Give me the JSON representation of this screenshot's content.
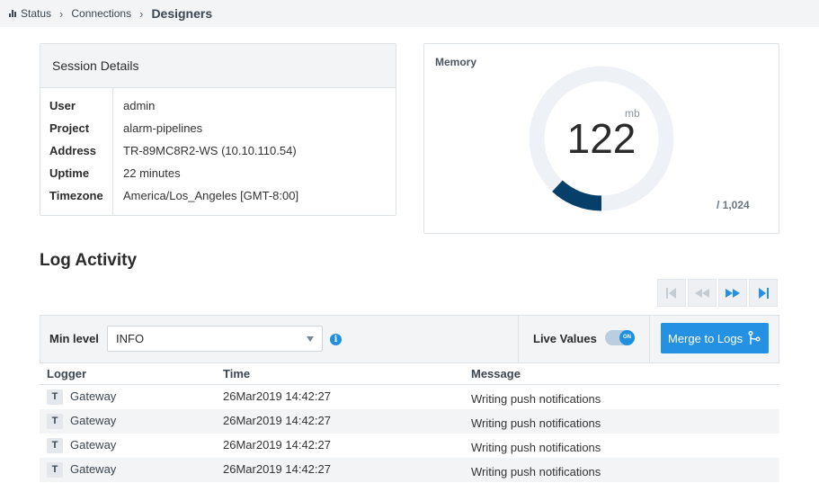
{
  "breadcrumb": {
    "items": [
      "Status",
      "Connections"
    ],
    "current": "Designers"
  },
  "session": {
    "title": "Session Details",
    "rows": [
      {
        "key": "User",
        "value": "admin"
      },
      {
        "key": "Project",
        "value": "alarm-pipelines"
      },
      {
        "key": "Address",
        "value": "TR-89MC8R2-WS (10.10.110.54)"
      },
      {
        "key": "Uptime",
        "value": "22 minutes"
      },
      {
        "key": "Timezone",
        "value": "America/Los_Angeles [GMT-8:00]"
      }
    ]
  },
  "memory": {
    "title": "Memory",
    "value": "122",
    "unit": "mb",
    "max_label": "/ 1,024",
    "used": 122,
    "total": 1024,
    "colors": {
      "track": "#eef2f6",
      "fill": "#053f6a"
    }
  },
  "log": {
    "title": "Log Activity",
    "pager_icons": [
      "first-page-icon",
      "previous-page-icon",
      "next-page-icon",
      "last-page-icon"
    ],
    "min_level_label": "Min level",
    "min_level_value": "INFO",
    "live_values_label": "Live Values",
    "toggle_text": "ON",
    "merge_button_label": "Merge to Logs",
    "columns": [
      "Logger",
      "Time",
      "Message"
    ],
    "rows": [
      {
        "badge": "T",
        "logger": "Gateway",
        "time": "26Mar2019 14:42:27",
        "message": "Writing push notifications"
      },
      {
        "badge": "T",
        "logger": "Gateway",
        "time": "26Mar2019 14:42:27",
        "message": "Writing push notifications"
      },
      {
        "badge": "T",
        "logger": "Gateway",
        "time": "26Mar2019 14:42:27",
        "message": "Writing push notifications"
      },
      {
        "badge": "T",
        "logger": "Gateway",
        "time": "26Mar2019 14:42:27",
        "message": "Writing push notifications"
      }
    ]
  },
  "colors": {
    "accent": "#2491e2",
    "panel": "#f2f4f6",
    "border": "#dde2e7"
  }
}
